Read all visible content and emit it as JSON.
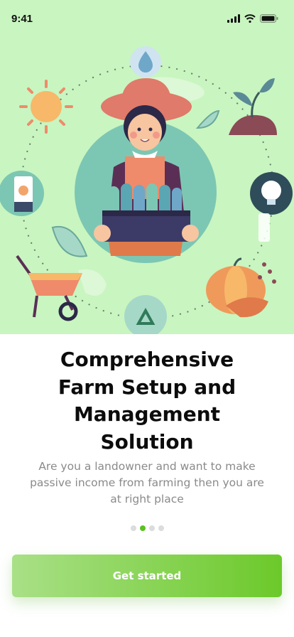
{
  "status_bar": {
    "time": "9:41",
    "icons": [
      "signal-icon",
      "wifi-icon",
      "battery-icon"
    ]
  },
  "hero": {
    "background": "#c9f5c0",
    "illustration": "farmer-holding-crate-icon",
    "surrounding_icons": [
      "water-drop-icon",
      "sun-icon",
      "plant-sprout-icon",
      "leaf-icon",
      "seed-packet-icon",
      "bulb-icon",
      "wheelbarrow-icon",
      "pumpkin-icon",
      "recycle-icon"
    ]
  },
  "onboarding": {
    "title": "Comprehensive Farm Setup and Management Solution",
    "subtitle": "Are you a landowner and want to make passive income from farming then you are at right place",
    "page_indicator": {
      "total": 4,
      "active_index": 1
    },
    "cta_label": "Get started"
  },
  "colors": {
    "accent": "#6cc92a",
    "dot_active": "#5cc022",
    "dot_inactive": "#dcdcdc"
  }
}
